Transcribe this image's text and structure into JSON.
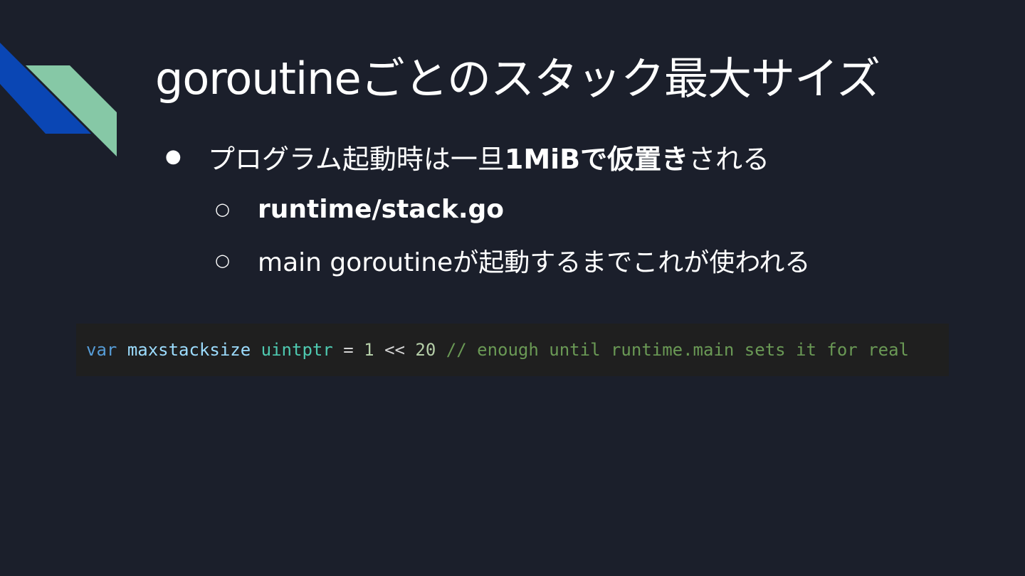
{
  "title": "goroutineごとのスタック最大サイズ",
  "bullets": {
    "level1": {
      "marker": "●",
      "before": "プログラム起動時は一旦",
      "bold": "1MiBで仮置き",
      "after": "される"
    },
    "level2": [
      {
        "marker": "○",
        "text": "runtime/stack.go",
        "bold": true
      },
      {
        "marker": "○",
        "text": "main goroutineが起動するまでこれが使われる",
        "bold": false
      }
    ]
  },
  "code": {
    "tokens": [
      {
        "text": "var",
        "color": "#569cd6"
      },
      {
        "text": " ",
        "color": "#d4d4d4"
      },
      {
        "text": "maxstacksize",
        "color": "#9cdcfe"
      },
      {
        "text": " ",
        "color": "#d4d4d4"
      },
      {
        "text": "uintptr",
        "color": "#4ec9b0"
      },
      {
        "text": " = ",
        "color": "#d4d4d4"
      },
      {
        "text": "1",
        "color": "#b5cea8"
      },
      {
        "text": " << ",
        "color": "#d4d4d4"
      },
      {
        "text": "20",
        "color": "#b5cea8"
      },
      {
        "text": " // enough until runtime.main sets it for real",
        "color": "#6a9955"
      }
    ]
  },
  "colors": {
    "background": "#1b1f2b",
    "text": "#ffffff",
    "deco_blue": "#0a46b4",
    "deco_green": "#86c8a6",
    "code_background": "#1f1f1f"
  }
}
